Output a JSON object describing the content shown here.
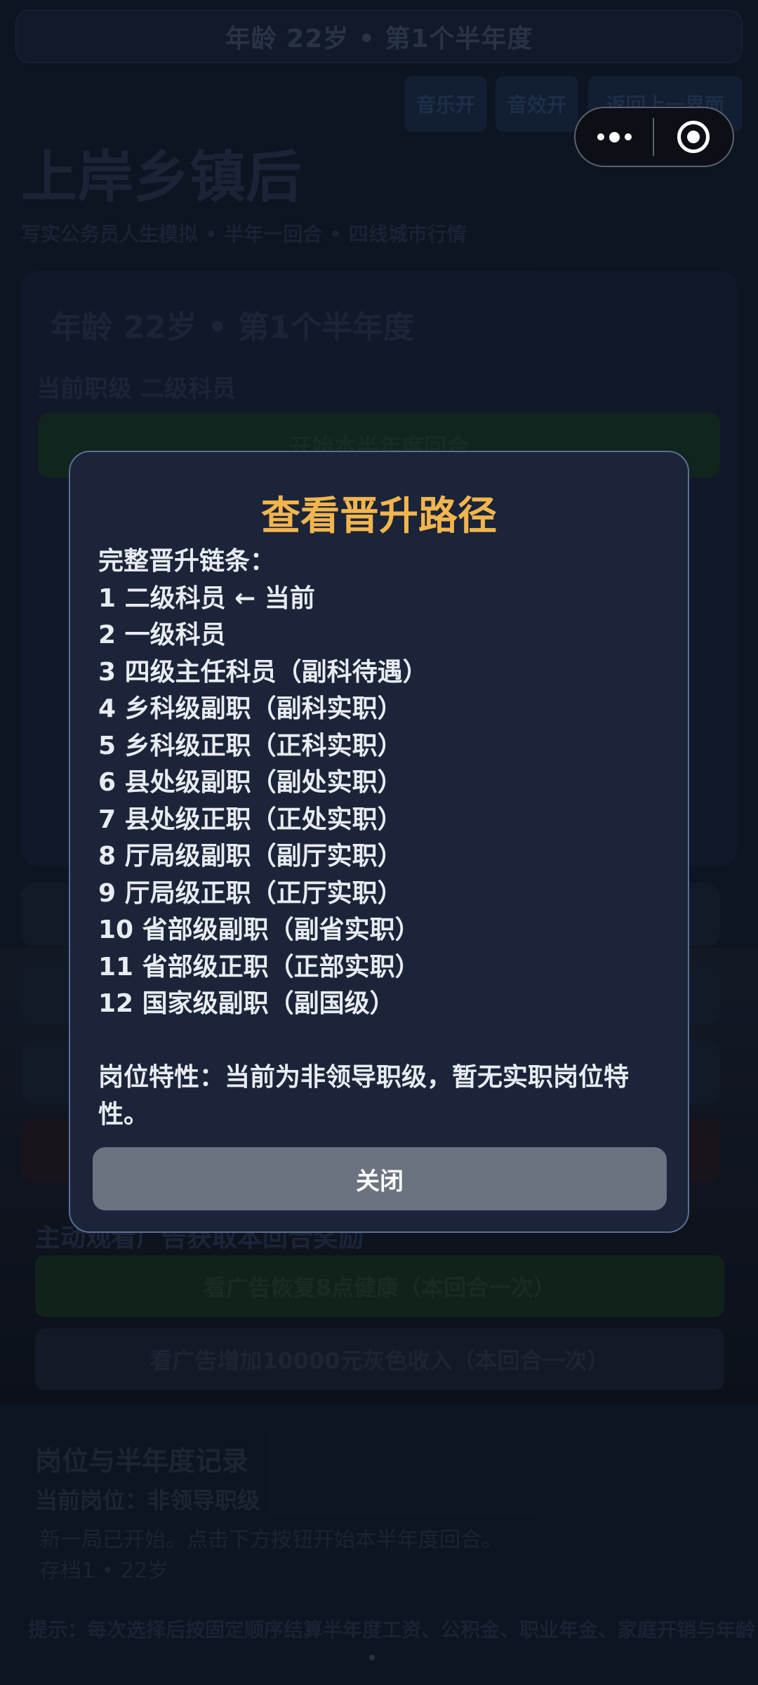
{
  "background": {
    "top_status": "年龄  22岁  •  第1个半年度",
    "chips": [
      "音乐开",
      "音效开",
      "返回上一界面"
    ],
    "title": "上岸乡镇后",
    "subtitle": "写实公务员人生模拟 • 半年一回合 • 四线城市行情",
    "card": {
      "age_line": "年龄  22岁  •  第1个半年度",
      "rank_line": "当前职级  二级科员",
      "start_button": "开始本半年度回合"
    },
    "ad_section": {
      "title": "主动观看广告获取本回合奖励",
      "btn_health": "看广告恢复8点健康（本回合一次）",
      "btn_income": "看广告增加10000元灰色收入（本回合一次）"
    },
    "record": {
      "title": "岗位与半年度记录",
      "position": "当前岗位：非领导职级",
      "line1": "新一局已开始。点击下方按钮开始本半年度回合。",
      "line2": "存档1 • 22岁"
    },
    "tip": "提示：每次选择后按固定顺序结算半年度工资、公积金、职业年金、家庭开销与年龄"
  },
  "modal": {
    "title": "查看晋升路径",
    "chain_header": "完整晋升链条：",
    "chain": [
      "1  二级科员  ← 当前",
      "2  一级科员",
      "3  四级主任科员（副科待遇）",
      "4  乡科级副职（副科实职）",
      "5  乡科级正职（正科实职）",
      "6  县处级副职（副处实职）",
      "7  县处级正职（正处实职）",
      "8  厅局级副职（副厅实职）",
      "9  厅局级正职（正厅实职）",
      "10  省部级副职（副省实职）",
      "11  省部级正职（正部实职）",
      "12  国家级副职（副国级）"
    ],
    "trait": "岗位特性：当前为非领导职级，暂无实职岗位特性。",
    "close_label": "关闭"
  },
  "colors": {
    "title_accent": "#f2b54e",
    "modal_bg": "#1b2438",
    "close_button": "#6b7280"
  }
}
